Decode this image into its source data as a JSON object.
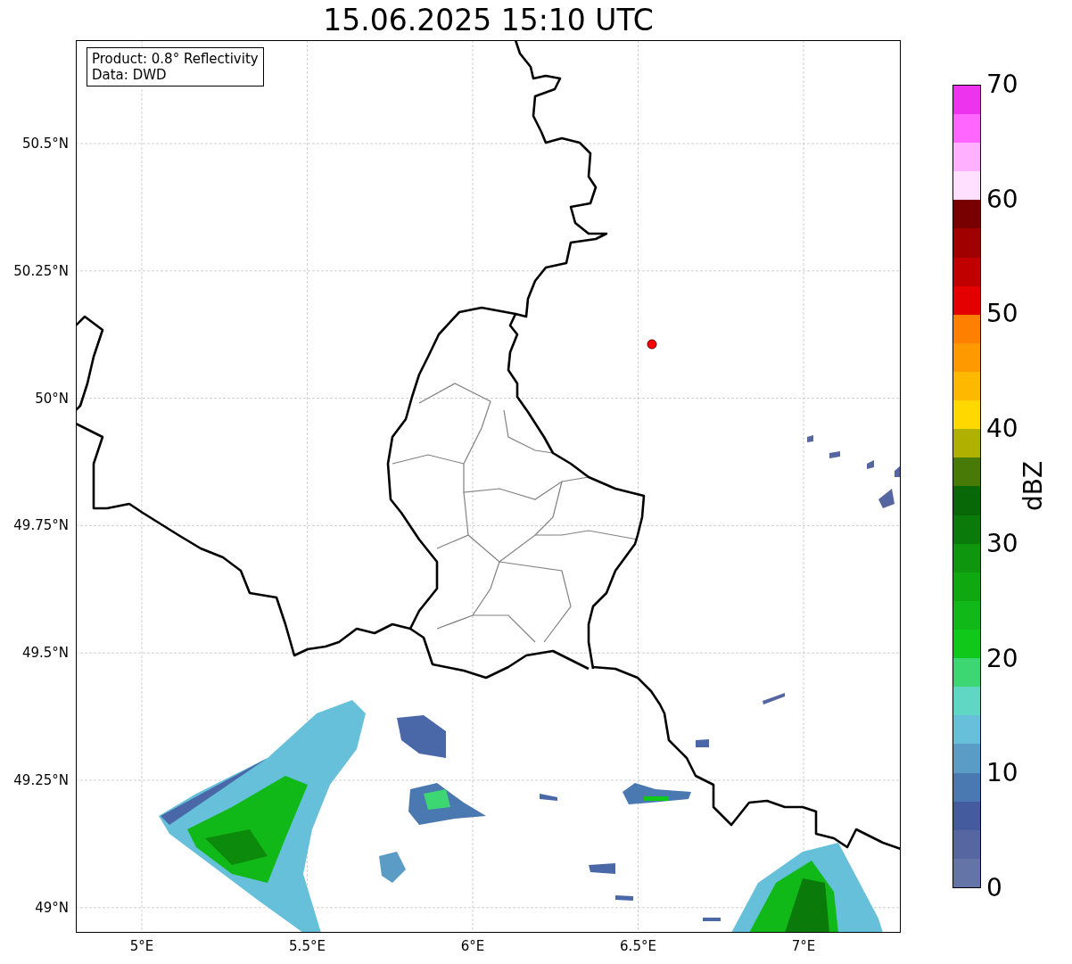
{
  "title": "15.06.2025 15:10 UTC",
  "info_box": {
    "lines": [
      "Product: 0.8° Reflectivity",
      "Data: DWD"
    ]
  },
  "map": {
    "lat_ticks": [
      "50.5°N",
      "50.25°N",
      "50°N",
      "49.75°N",
      "49.5°N",
      "49.25°N",
      "49°N"
    ],
    "lon_ticks": [
      "5°E",
      "5.5°E",
      "6°E",
      "6.5°E",
      "7°E"
    ]
  },
  "colorbar": {
    "label": "dBZ",
    "ticks": [
      "70",
      "60",
      "50",
      "40",
      "30",
      "20",
      "10",
      "0"
    ],
    "segments": [
      {
        "color": "#6474a6"
      },
      {
        "color": "#5566a0"
      },
      {
        "color": "#445c9e"
      },
      {
        "color": "#4a78b0"
      },
      {
        "color": "#5a9cc6"
      },
      {
        "color": "#66c0da"
      },
      {
        "color": "#60d6c4"
      },
      {
        "color": "#3cd672"
      },
      {
        "color": "#10c81a"
      },
      {
        "color": "#10b818"
      },
      {
        "color": "#10a810"
      },
      {
        "color": "#0e960e"
      },
      {
        "color": "#0a7a0a"
      },
      {
        "color": "#086808"
      },
      {
        "color": "#487a08"
      },
      {
        "color": "#b0b000"
      },
      {
        "color": "#ffd800"
      },
      {
        "color": "#ffb800"
      },
      {
        "color": "#ff9900"
      },
      {
        "color": "#ff7f00"
      },
      {
        "color": "#e40000"
      },
      {
        "color": "#c00000"
      },
      {
        "color": "#a00000"
      },
      {
        "color": "#780000"
      },
      {
        "color": "#ffe0ff"
      },
      {
        "color": "#ffb0ff"
      },
      {
        "color": "#ff66ff"
      },
      {
        "color": "#ee33ee"
      }
    ]
  }
}
